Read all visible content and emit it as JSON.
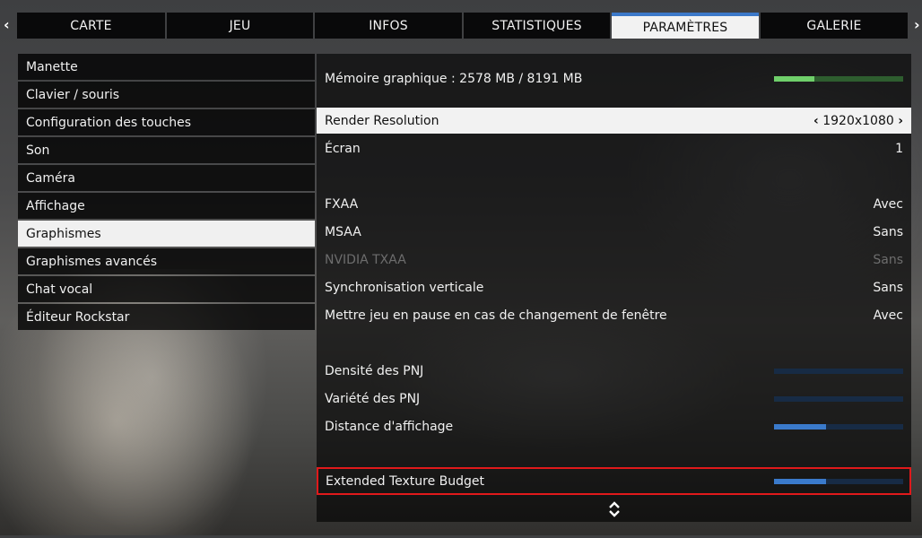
{
  "tabs": [
    {
      "label": "CARTE",
      "active": false
    },
    {
      "label": "JEU",
      "active": false
    },
    {
      "label": "INFOS",
      "active": false
    },
    {
      "label": "STATISTIQUES",
      "active": false
    },
    {
      "label": "PARAMÈTRES",
      "active": true
    },
    {
      "label": "GALERIE",
      "active": false
    }
  ],
  "nav": {
    "prev": "‹",
    "next": "›"
  },
  "menu": [
    {
      "label": "Manette"
    },
    {
      "label": "Clavier / souris"
    },
    {
      "label": "Configuration des touches"
    },
    {
      "label": "Son"
    },
    {
      "label": "Caméra"
    },
    {
      "label": "Affichage"
    },
    {
      "label": "Graphismes",
      "active": true
    },
    {
      "label": "Graphismes avancés"
    },
    {
      "label": "Chat vocal"
    },
    {
      "label": "Éditeur Rockstar"
    }
  ],
  "memory": {
    "label": "Mémoire graphique : 2578 MB / 8191 MB",
    "used_fraction": 0.31
  },
  "settings": {
    "render_resolution": {
      "label": "Render Resolution",
      "value": "1920x1080",
      "prev": "‹",
      "next": "›"
    },
    "ecran": {
      "label": "Écran",
      "value": "1"
    },
    "fxaa": {
      "label": "FXAA",
      "value": "Avec"
    },
    "msaa": {
      "label": "MSAA",
      "value": "Sans"
    },
    "txaa": {
      "label": "NVIDIA TXAA",
      "value": "Sans"
    },
    "vsync": {
      "label": "Synchronisation verticale",
      "value": "Sans"
    },
    "pause": {
      "label": "Mettre jeu en pause en cas de changement de fenêtre",
      "value": "Avec"
    },
    "pnj_density": {
      "label": "Densité des PNJ",
      "level": 0.0
    },
    "pnj_variety": {
      "label": "Variété des PNJ",
      "level": 0.0
    },
    "draw_distance": {
      "label": "Distance d'affichage",
      "level": 0.4
    },
    "texture_budget": {
      "label": "Extended Texture Budget",
      "level": 0.4
    }
  },
  "colors": {
    "accent": "#3b78c8",
    "memory_bar": "#6fcf6a",
    "highlight_border": "#e0191b"
  },
  "footer": {
    "icon": "up-down-arrows-icon"
  }
}
